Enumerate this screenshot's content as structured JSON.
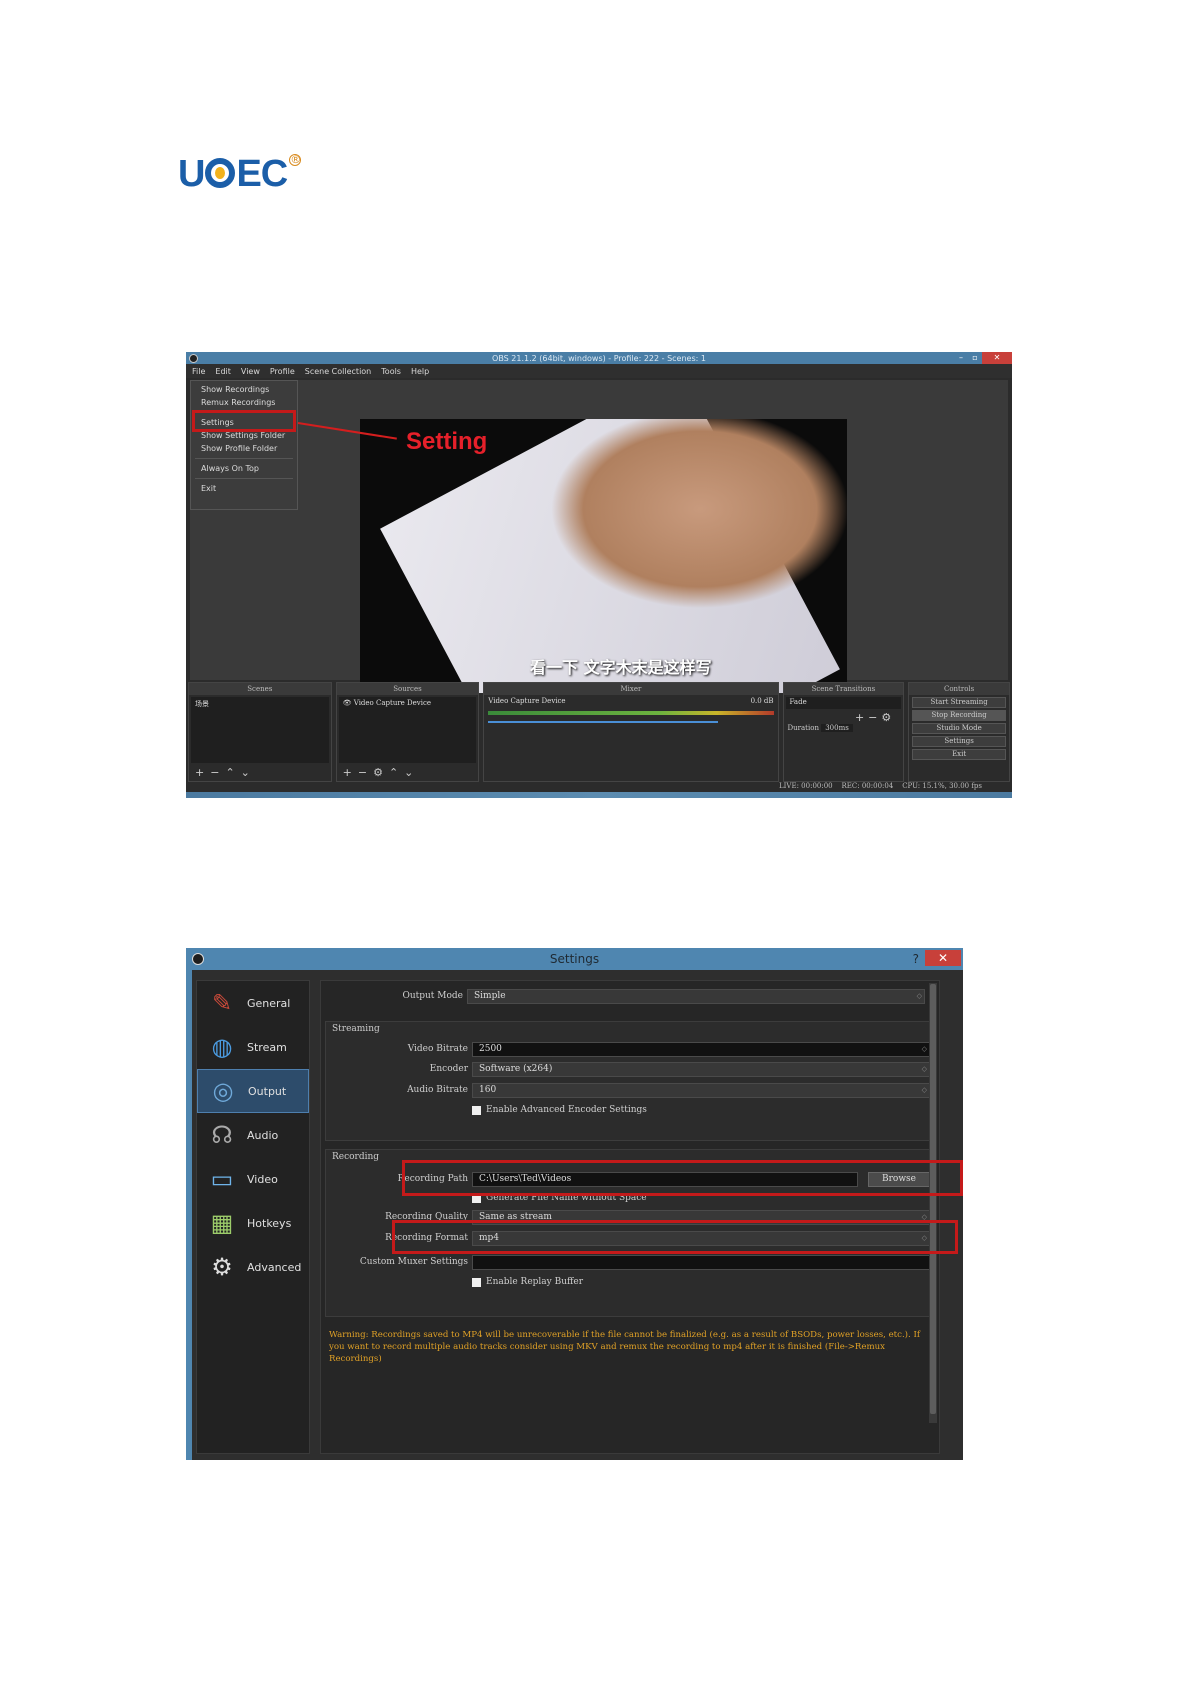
{
  "logo": {
    "text": "UCEC",
    "mark": "®"
  },
  "obs": {
    "title": "OBS 21.1.2 (64bit, windows) - Profile: 222 - Scenes: 1",
    "menu": [
      "File",
      "Edit",
      "View",
      "Profile",
      "Scene Collection",
      "Tools",
      "Help"
    ],
    "file_menu": [
      "Show Recordings",
      "Remux Recordings",
      "Settings",
      "Show Settings Folder",
      "Show Profile Folder",
      "Always On Top",
      "Exit"
    ],
    "callout": "Setting",
    "subtitle": "看一下 文字木末是这样写",
    "docks": {
      "scenes": {
        "title": "Scenes",
        "item": "场景"
      },
      "sources": {
        "title": "Sources",
        "item": "Video Capture Device"
      },
      "mixer": {
        "title": "Mixer",
        "item": "Video Capture Device",
        "db": "0.0 dB"
      },
      "transitions": {
        "title": "Scene Transitions",
        "type": "Fade",
        "duration_label": "Duration",
        "duration": "300ms"
      },
      "controls": {
        "title": "Controls",
        "buttons": [
          "Start Streaming",
          "Stop Recording",
          "Studio Mode",
          "Settings",
          "Exit"
        ]
      }
    },
    "status": {
      "live": "LIVE: 00:00:00",
      "rec": "REC: 00:00:04",
      "cpu": "CPU: 15.1%, 30.00 fps"
    }
  },
  "settings": {
    "title": "Settings",
    "help": "?",
    "close": "✕",
    "nav": [
      {
        "label": "General",
        "icon": "general-icon"
      },
      {
        "label": "Stream",
        "icon": "globe-icon"
      },
      {
        "label": "Output",
        "icon": "output-icon"
      },
      {
        "label": "Audio",
        "icon": "headset-icon"
      },
      {
        "label": "Video",
        "icon": "monitor-icon"
      },
      {
        "label": "Hotkeys",
        "icon": "keyboard-icon"
      },
      {
        "label": "Advanced",
        "icon": "gears-icon"
      }
    ],
    "output_mode": {
      "label": "Output Mode",
      "value": "Simple"
    },
    "streaming": {
      "heading": "Streaming",
      "video_bitrate": {
        "label": "Video Bitrate",
        "value": "2500"
      },
      "encoder": {
        "label": "Encoder",
        "value": "Software (x264)"
      },
      "audio_bitrate": {
        "label": "Audio Bitrate",
        "value": "160"
      },
      "advanced": "Enable Advanced Encoder Settings"
    },
    "recording": {
      "heading": "Recording",
      "path": {
        "label": "Recording Path",
        "value": "C:\\Users\\Ted\\Videos",
        "browse": "Browse"
      },
      "nospace": "Generate File Name without Space",
      "quality": {
        "label": "Recording Quality",
        "value": "Same as stream"
      },
      "format": {
        "label": "Recording Format",
        "value": "mp4"
      },
      "muxer": {
        "label": "Custom Muxer Settings",
        "value": ""
      },
      "replay": "Enable Replay Buffer"
    },
    "warning": "Warning: Recordings saved to MP4 will be unrecoverable if the file cannot be finalized (e.g. as a result of BSODs, power losses, etc.). If you want to record multiple audio tracks consider using MKV and remux the recording to mp4 after it is finished (File->Remux Recordings)"
  },
  "colors": {
    "highlight": "#c41a1a",
    "warning": "#e0a126",
    "titlebar": "#4f86b0"
  }
}
